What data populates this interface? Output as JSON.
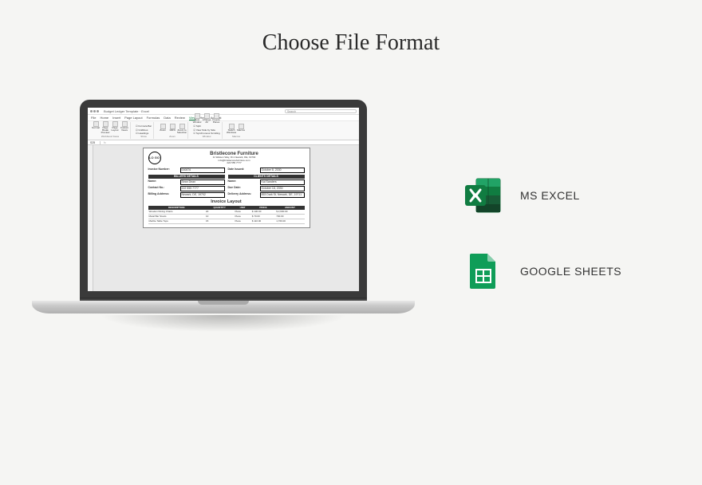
{
  "page_title": "Choose File Format",
  "options": [
    {
      "label": "MS EXCEL"
    },
    {
      "label": "GOOGLE SHEETS"
    }
  ],
  "excel_preview": {
    "title": "Budget Ledger Template · Excel",
    "search_placeholder": "Search",
    "menu": [
      "File",
      "Home",
      "Insert",
      "Page Layout",
      "Formulas",
      "Data",
      "Review",
      "View",
      "Help",
      "Acrobat"
    ],
    "active_menu": "View",
    "ribbon": {
      "groups": [
        {
          "label": "Workbook Views",
          "buttons": [
            "Normal",
            "Page Break Preview",
            "Page Layout",
            "Custom Views"
          ]
        },
        {
          "label": "Show",
          "checks": [
            "Ruler",
            "Formula Bar",
            "Gridlines",
            "Headings"
          ]
        },
        {
          "label": "Zoom",
          "buttons": [
            "Zoom",
            "100%",
            "Zoom to Selection"
          ]
        },
        {
          "label": "Window",
          "buttons": [
            "New Window",
            "Arrange All",
            "Freeze Panes"
          ],
          "checks": [
            "Split",
            "Hide",
            "View Side by Side",
            "Synchronous Scrolling",
            "Reset Window Position"
          ]
        },
        {
          "label": "Macros",
          "buttons": [
            "Switch Windows",
            "Macros"
          ]
        }
      ]
    },
    "cell_reference": "S25",
    "document": {
      "logo_text": "LO GO",
      "company_name": "Bristlecone Furniture",
      "address_line1": "11 Watson Way, Dm Newark, DE, 19702",
      "email": "info@bristleconefurniture.com",
      "phone": "222 555 7777",
      "invoice_number_label": "Invoice Number:",
      "invoice_number": "000876",
      "date_issued_label": "Date Issued:",
      "date_issued": "October 8, 2030",
      "billers_header": "BILLERS DETAILS",
      "clients_header": "CLIENTS DETAILS",
      "fields": {
        "biller_name_label": "Name:",
        "biller_name": "Sean Dean",
        "biller_contact_label": "Contact No.:",
        "biller_contact": "222 555 7777",
        "biller_address_label": "Billing Address:",
        "biller_address": "Newark, DE, 19702",
        "client_name_label": "Name:",
        "client_name": "Kai Sanders",
        "due_date_label": "Due Date:",
        "due_date": "October 18, 2030",
        "delivery_address_label": "Delivery Address:",
        "delivery_address": "853 Dark St, Newark, DE, 19711"
      },
      "layout_title": "Invoice Layout",
      "table": {
        "headers": [
          "DESCRIPTION",
          "QUANTITY",
          "UNIT",
          "PRICE",
          "AMOUNT"
        ],
        "rows": [
          [
            "Wooden Dining Chairs",
            "20",
            "Piece",
            "$  130.00",
            "$  2,600.00"
          ],
          [
            "Metal Bar Stools",
            "10",
            "Piece",
            "$   70.00",
            "700.00"
          ],
          [
            "Marble Table Tops",
            "15",
            "Piece",
            "$  110.00",
            "1,760.00"
          ]
        ]
      }
    }
  }
}
